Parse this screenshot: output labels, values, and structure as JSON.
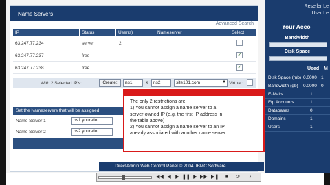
{
  "panel": {
    "title": "Name Servers",
    "advanced_search": "Advanced Search",
    "columns": [
      "IP",
      "Status",
      "User(s)",
      "Nameserver",
      "Select"
    ],
    "rows": [
      {
        "ip": "63.247.77.234",
        "status": "server",
        "users": "2",
        "nameserver": "",
        "checked": false
      },
      {
        "ip": "63.247.77.237",
        "status": "free",
        "users": "",
        "nameserver": "",
        "checked": true
      },
      {
        "ip": "63.247.77.238",
        "status": "free",
        "users": "",
        "nameserver": "",
        "checked": true
      }
    ],
    "create_bar": {
      "label": "With 2 Selected IP's:",
      "create_button": "Create:",
      "ns1": "ns1",
      "amp": "&",
      "ns2": "ns2",
      "domain": "site101.com",
      "virtual_label": "Virtual:"
    },
    "nameserver_section": {
      "header": "Set the Nameservers that will be assigned",
      "ns1_label": "Name Server 1",
      "ns1_value": "ns1.your-do",
      "ns2_label": "Name Server 2",
      "ns2_value": "ns2.your-do"
    },
    "footer_small": "",
    "footer": "DirectAdmin Web Control Panel © 2004 JBMC Software"
  },
  "tooltip": {
    "lines": [
      "The only 2 restrictions are:",
      "1) You cannot assign a name server to a",
      "server-owned IP (e.g. the first IP address in",
      "the table above)",
      "2) You cannot assign a name server to an IP",
      "already associated with another name server"
    ]
  },
  "right_panel": {
    "top_line1": "Reseller Le",
    "top_line2": "User Le",
    "account_title": "Your Acco",
    "bandwidth": "Bandwidth",
    "disk_space": "Disk Space",
    "col_used": "Used",
    "col_max": "M",
    "stats": [
      {
        "key": "Disk Space (mb)",
        "used": "0.0000",
        "max": "1"
      },
      {
        "key": "Bandwidth (gb)",
        "used": "0.0000",
        "max": "0"
      },
      {
        "key": "E-Mails",
        "used": "1",
        "max": ""
      },
      {
        "key": "Ftp Accounts",
        "used": "1",
        "max": ""
      },
      {
        "key": "Databases",
        "used": "0",
        "max": ""
      },
      {
        "key": "Domains",
        "used": "1",
        "max": ""
      },
      {
        "key": "Users",
        "used": "1",
        "max": ""
      }
    ]
  },
  "colors": {
    "brand_blue": "#1a3c6e",
    "header_blue": "#2b4f80",
    "tooltip_red": "#d91a1a"
  }
}
